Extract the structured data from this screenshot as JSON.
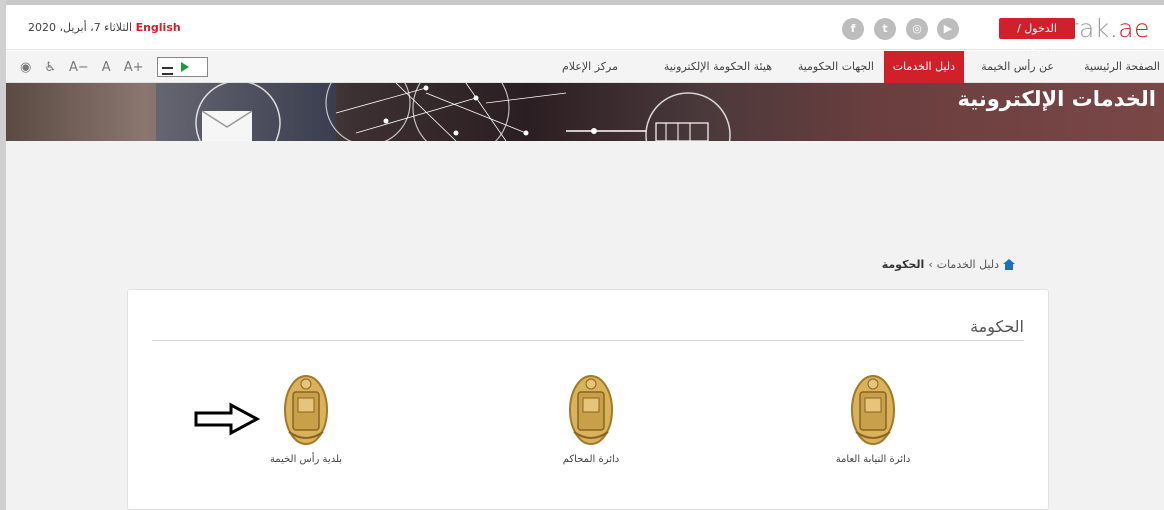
{
  "header": {
    "logo_text": "rak",
    "logo_suffix": ".ae",
    "login_label": "الدخول / التسجيل",
    "date_text": "الثلاثاء 7، أبريل، 2020",
    "language_link": "English",
    "social_icons": [
      "facebook-icon",
      "twitter-icon",
      "instagram-icon",
      "youtube-icon"
    ]
  },
  "nav": {
    "items": [
      {
        "label": "الصفحة الرئيسية"
      },
      {
        "label": "عن رأس الخيمة"
      },
      {
        "label": "دليل الخدمات"
      },
      {
        "label": "الجهات الحكومية"
      },
      {
        "label": "هيئة الحكومة الإلكترونية"
      },
      {
        "label": "مركز الإعلام"
      }
    ],
    "active_item": "دليل الخدمات",
    "tools": {
      "font_increase": "A+",
      "font_normal": "A",
      "font_decrease": "A−"
    }
  },
  "banner": {
    "title": "الخدمات الإلكترونية"
  },
  "breadcrumb": {
    "parent": "دليل الخدمات",
    "separator": "›",
    "current": "الحكومة"
  },
  "section": {
    "title": "الحكومة",
    "entities": [
      {
        "label": "دائرة النيابة العامة",
        "icon": "rak-emblem-icon"
      },
      {
        "label": "دائرة المحاكم",
        "icon": "rak-emblem-icon"
      },
      {
        "label": "بلدية رأس الخيمة",
        "icon": "rak-emblem-icon"
      }
    ]
  },
  "colors": {
    "accent_red": "#d0202a",
    "emblem_gold": "#c9a04a",
    "page_grey": "#f2f2f2"
  }
}
